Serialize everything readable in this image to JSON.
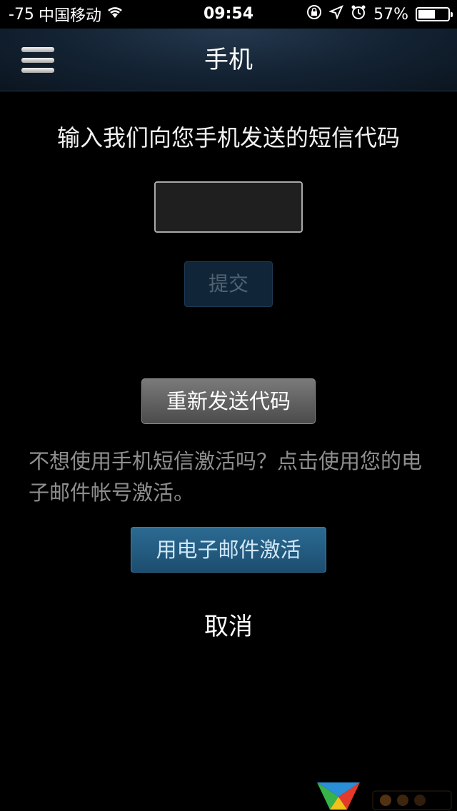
{
  "status_bar": {
    "signal": "-75",
    "carrier": "中国移动",
    "time": "09:54",
    "battery_percent": "57%",
    "battery_level": 0.57,
    "icons": [
      "wifi-icon",
      "rotation-lock-icon",
      "location-icon",
      "alarm-icon",
      "battery-icon"
    ]
  },
  "nav": {
    "title": "手机",
    "menu_icon": "hamburger-menu-icon"
  },
  "main": {
    "prompt": "输入我们向您手机发送的短信代码",
    "code_input": {
      "value": "",
      "placeholder": ""
    },
    "submit_label": "提交",
    "resend_label": "重新发送代码",
    "alt_text": "不想使用手机短信激活吗？点击使用您的电子邮件帐号激活。",
    "email_button_label": "用电子邮件激活",
    "cancel_label": "取消"
  },
  "colors": {
    "background": "#000000",
    "nav_background": "#132232",
    "submit_disabled": "#102638",
    "email_button": "#2c6a92",
    "muted_text": "#8e8e8e"
  }
}
